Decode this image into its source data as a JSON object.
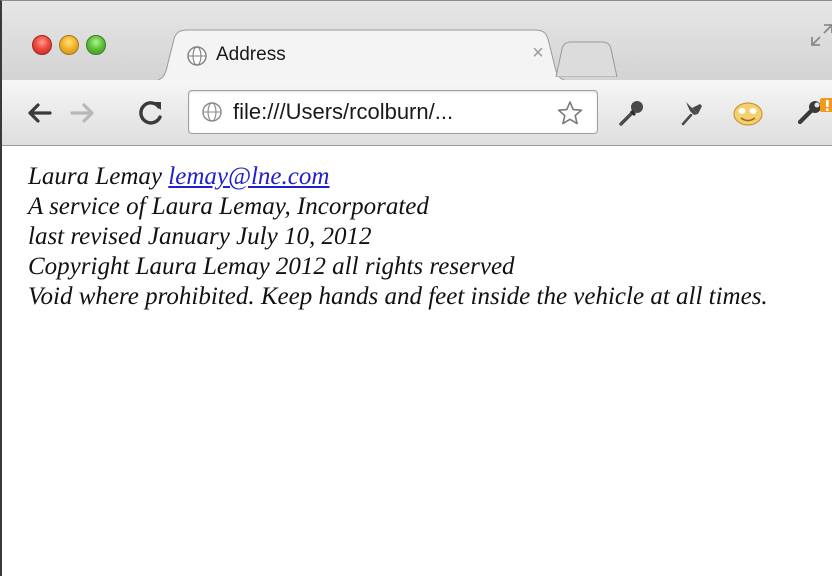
{
  "browser": {
    "tab": {
      "title": "Address",
      "close_glyph": "×",
      "favicon": "globe-icon"
    },
    "toolbar": {
      "back": "arrow-left-icon",
      "forward": "arrow-right-icon",
      "reload": "reload-icon",
      "url": "file:///Users/rcolburn/...",
      "url_icon": "globe-icon",
      "bookmark": "star-icon",
      "extensions": [
        "eyedropper-icon",
        "pin-icon",
        "smiley-extension-icon"
      ],
      "menu": "wrench-icon"
    }
  },
  "address": {
    "name": "Laura Lemay",
    "email": "lemay@lne.com",
    "lines": [
      "A service of Laura Lemay, Incorporated",
      "last revised January July 10, 2012",
      "Copyright Laura Lemay 2012 all rights reserved",
      "Void where prohibited. Keep hands and feet inside the vehicle at all times."
    ]
  },
  "colors": {
    "link": "#1f1fd0",
    "text": "#111111",
    "chrome": "#d8d8d8"
  }
}
